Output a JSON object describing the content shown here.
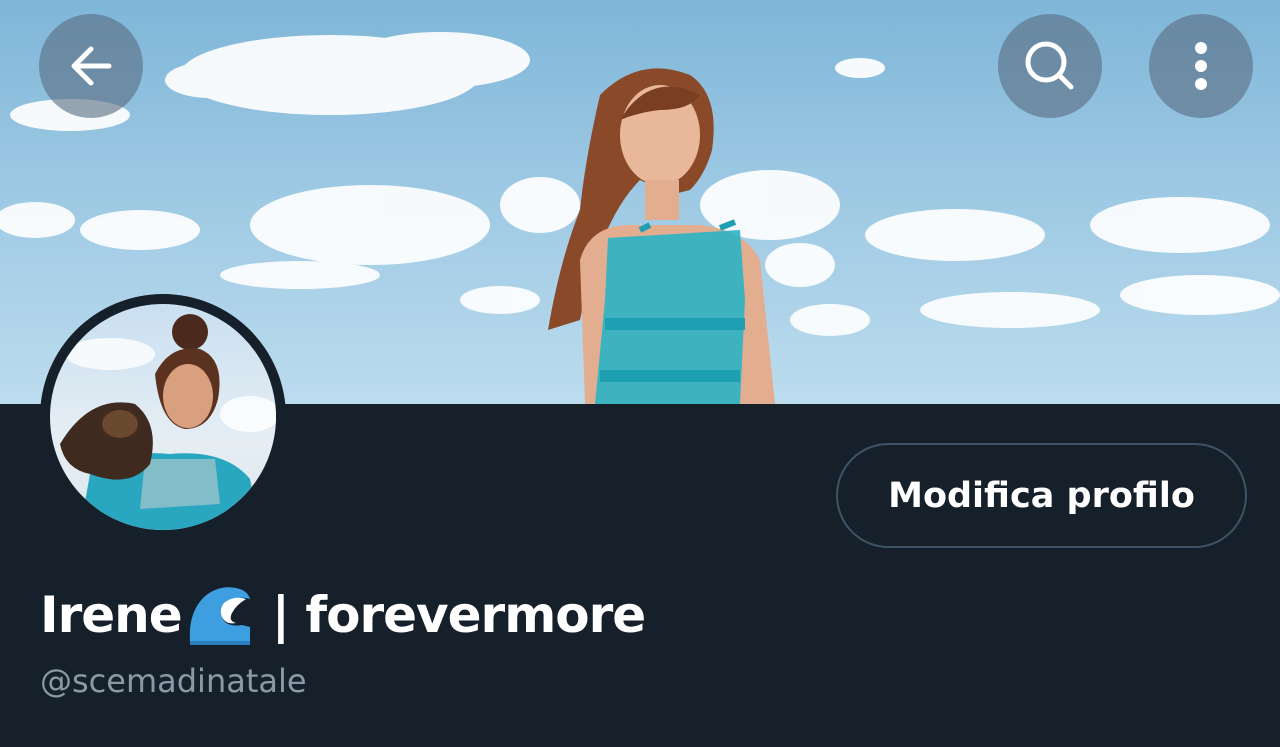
{
  "header": {
    "back_icon": "arrow-left-icon",
    "search_icon": "search-icon",
    "more_icon": "more-vertical-icon"
  },
  "profile": {
    "display_name_first": "Irene",
    "display_name_emoji": "water-wave-emoji",
    "display_name_rest": "| forevermore",
    "handle": "@scemadinatale",
    "edit_button_label": "Modifica profilo"
  },
  "colors": {
    "background": "#16202b",
    "handle_text": "#8b98a5",
    "button_border": "#3d5466",
    "banner_sky": "#9cc8e3",
    "accent_teal": "#2fb3c4"
  }
}
